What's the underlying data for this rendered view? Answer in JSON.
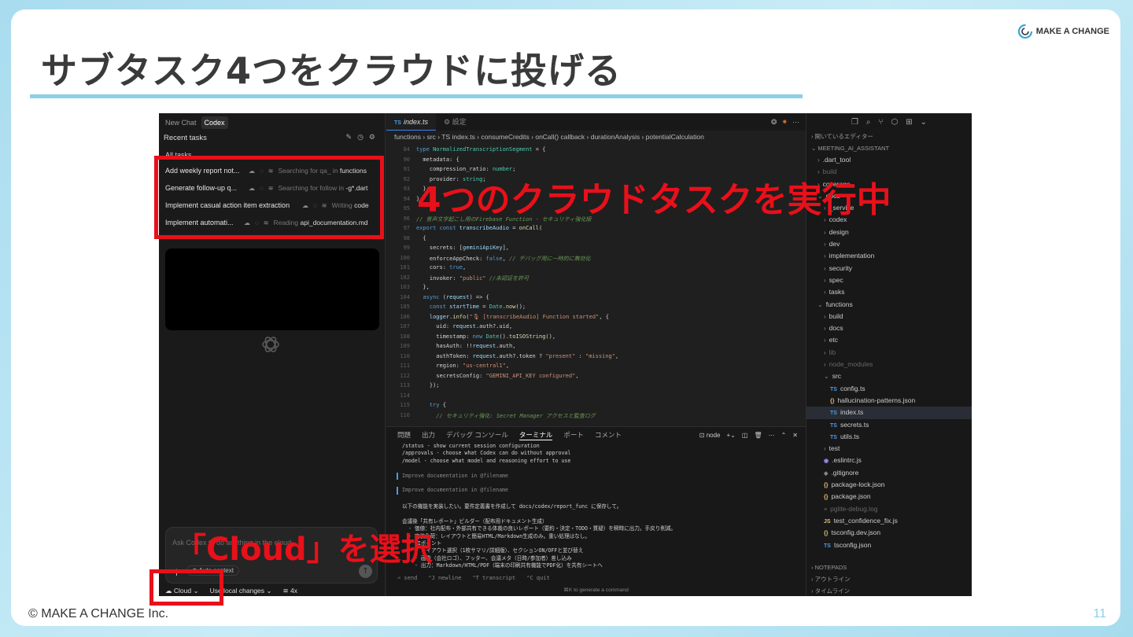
{
  "slide": {
    "title": "サブタスク4つをクラウドに投げる",
    "logo_text": "MAKE A CHANGE",
    "copyright": "© MAKE A CHANGE Inc.",
    "page_number": "11"
  },
  "annotations": {
    "tasks_label": "4つのクラウドタスクを実行中",
    "cloud_label": "「Cloud」を選択"
  },
  "codex": {
    "tabs": [
      "New Chat",
      "Codex"
    ],
    "recent_label": "Recent tasks",
    "all_tasks_label": "All tasks",
    "tasks": [
      {
        "title": "Add weekly report not...",
        "status": "Searching for qa_ in",
        "status_hl": "functions"
      },
      {
        "title": "Generate follow-up q...",
        "status": "Searching for follow in",
        "status_hl": "-g*.dart"
      },
      {
        "title": "Implement casual action item extraction",
        "status": "Writing",
        "status_hl": "code"
      },
      {
        "title": "Implement automati...",
        "status": "Reading",
        "status_hl": "api_documentation.md"
      }
    ],
    "prompt_placeholder": "Ask Codex to do anything in the cloud",
    "auto_context": "Auto context",
    "bottom": {
      "cloud": "Cloud",
      "local": "Use local changes",
      "count": "4x"
    }
  },
  "editor": {
    "tabs": [
      {
        "label": "index.ts",
        "active": true
      },
      {
        "label": "設定",
        "active": false
      }
    ],
    "breadcrumb": "functions › src › TS index.ts › consumeCredits › onCall() callback › durationAnalysis › potentialCalculation",
    "lines": [
      {
        "n": "84",
        "html": "<span class='k'>type</span> <span class='t'>NormalizedTranscriptionSegment</span> = {"
      },
      {
        "n": "90",
        "html": "  metadata: {"
      },
      {
        "n": "91",
        "html": "    compression_ratio: <span class='t'>number</span>;"
      },
      {
        "n": "92",
        "html": "    provider: <span class='t'>string</span>;"
      },
      {
        "n": "93",
        "html": "  };"
      },
      {
        "n": "94",
        "html": "};"
      },
      {
        "n": "95",
        "html": ""
      },
      {
        "n": "96",
        "html": "<span class='c'>// 音声文字起こし用のFirebase Function - セキュリティ強化版</span>"
      },
      {
        "n": "97",
        "html": "<span class='k'>export const</span> <span class='v'>transcribeAudio</span> = <span class='f'>onCall</span>("
      },
      {
        "n": "98",
        "html": "  {"
      },
      {
        "n": "99",
        "html": "    secrets: [<span class='v'>geminiApiKey</span>],"
      },
      {
        "n": "100",
        "html": "    enforceAppCheck: <span class='k'>false</span>, <span class='c'>// デバッグ用に一時的に無効化</span>"
      },
      {
        "n": "101",
        "html": "    cors: <span class='k'>true</span>,"
      },
      {
        "n": "102",
        "html": "    invoker: <span class='s'>\"public\"</span> <span class='c'>//未認証を許可</span>"
      },
      {
        "n": "103",
        "html": "  },"
      },
      {
        "n": "104",
        "html": "  <span class='k'>async</span> (<span class='v'>request</span>) => {"
      },
      {
        "n": "105",
        "html": "    <span class='k'>const</span> <span class='v'>startTime</span> = <span class='t'>Date</span>.<span class='f'>now</span>();"
      },
      {
        "n": "106",
        "html": "    <span class='v'>logger</span>.<span class='f'>info</span>(<span class='s'>\"🎙 [transcribeAudio] Function started\"</span>, {"
      },
      {
        "n": "107",
        "html": "      uid: <span class='v'>request</span>.auth?.uid,"
      },
      {
        "n": "108",
        "html": "      timestamp: <span class='k'>new</span> <span class='t'>Date</span>().<span class='f'>toISOString</span>(),"
      },
      {
        "n": "109",
        "html": "      hasAuth: !!<span class='v'>request</span>.auth,"
      },
      {
        "n": "110",
        "html": "      authToken: <span class='v'>request</span>.auth?.token ? <span class='s'>\"present\"</span> : <span class='s'>\"missing\"</span>,"
      },
      {
        "n": "111",
        "html": "      region: <span class='s'>\"us-central1\"</span>,"
      },
      {
        "n": "112",
        "html": "      secretsConfig: <span class='s'>\"GEMINI_API_KEY configured\"</span>,"
      },
      {
        "n": "113",
        "html": "    });"
      },
      {
        "n": "114",
        "html": ""
      },
      {
        "n": "115",
        "html": "    <span class='k'>try</span> {"
      },
      {
        "n": "116",
        "html": "      <span class='c'>// セキュリティ強化: Secret Manager アクセスと監査ログ</span>"
      }
    ]
  },
  "terminal": {
    "tabs": [
      "問題",
      "出力",
      "デバッグ コンソール",
      "ターミナル",
      "ポート",
      "コメント"
    ],
    "active_tab": "ターミナル",
    "shell": "node",
    "lines": [
      {
        "cls": "",
        "text": "/status - show current session configuration"
      },
      {
        "cls": "",
        "text": "/approvals - choose what Codex can do without approval"
      },
      {
        "cls": "",
        "text": "/model - choose what model and reasoning effort to use"
      },
      {
        "cls": "",
        "text": ""
      },
      {
        "cls": "bar",
        "text": "Improve documentation in @filename"
      },
      {
        "cls": "",
        "text": ""
      },
      {
        "cls": "bar",
        "text": "Improve documentation in @filename"
      },
      {
        "cls": "",
        "text": ""
      },
      {
        "cls": "",
        "text": "以下の機能を実装したい。要件定義書を作成して docs/codex/report_func に保存して。"
      },
      {
        "cls": "",
        "text": ""
      },
      {
        "cls": "",
        "text": "会議後「共有レポート」ビルダー（配布用ドキュメント生成）"
      },
      {
        "cls": "",
        "text": "  - 価値：社内配布・外部共有できる体裁の良いレポート（要約・決定・TODO・質疑）を瞬時に出力。手戻り削減。"
      },
      {
        "cls": "",
        "text": "  - 実装負荷：レイアウトと簡易HTML/Markdown生成のみ。重い処理はなし。"
      },
      {
        "cls": "",
        "text": "  - UIポイント"
      },
      {
        "cls": "",
        "text": "    - レイアウト選択（1枚サマリ/詳細版）、セクションON/OFFと並び替え"
      },
      {
        "cls": "",
        "text": "    - 画像（会社ロゴ）、フッター、会議メタ（日時/参加者）差し込み"
      },
      {
        "cls": "",
        "text": "    - 出力：Markdown/HTML/PDF（端末の印刷共有機能でPDF化）を共有シートへ"
      }
    ],
    "footer": [
      "⏎ send",
      "⌃J newline",
      "⌃T transcript",
      "⌃C quit"
    ],
    "hint": "⌘K to generate a command"
  },
  "explorer": {
    "open_editors": "開いているエディター",
    "project": "MEETING_AI_ASSISTANT",
    "items": [
      {
        "label": ".dart_tool",
        "kind": "folder",
        "indent": 1,
        "dim": false
      },
      {
        "label": "build",
        "kind": "folder",
        "indent": 1,
        "dim": true
      },
      {
        "label": "coverage",
        "kind": "folder",
        "indent": 1,
        "dim": false
      },
      {
        "label": "docs",
        "kind": "folder-open",
        "indent": 1,
        "dim": false
      },
      {
        "label": "_service",
        "kind": "folder",
        "indent": 2,
        "dim": false
      },
      {
        "label": "codex",
        "kind": "folder",
        "indent": 2,
        "dim": false
      },
      {
        "label": "design",
        "kind": "folder",
        "indent": 2,
        "dim": false
      },
      {
        "label": "dev",
        "kind": "folder",
        "indent": 2,
        "dim": false
      },
      {
        "label": "implementation",
        "kind": "folder",
        "indent": 2,
        "dim": false
      },
      {
        "label": "security",
        "kind": "folder",
        "indent": 2,
        "dim": false
      },
      {
        "label": "spec",
        "kind": "folder",
        "indent": 2,
        "dim": false
      },
      {
        "label": "tasks",
        "kind": "folder",
        "indent": 2,
        "dim": false
      },
      {
        "label": "functions",
        "kind": "folder-open",
        "indent": 1,
        "dim": false
      },
      {
        "label": "build",
        "kind": "folder",
        "indent": 2,
        "dim": false
      },
      {
        "label": "docs",
        "kind": "folder",
        "indent": 2,
        "dim": false
      },
      {
        "label": "etc",
        "kind": "folder",
        "indent": 2,
        "dim": false
      },
      {
        "label": "lib",
        "kind": "folder",
        "indent": 2,
        "dim": true
      },
      {
        "label": "node_modules",
        "kind": "folder",
        "indent": 2,
        "dim": true
      },
      {
        "label": "src",
        "kind": "folder-open",
        "indent": 2,
        "dim": false
      },
      {
        "label": "config.ts",
        "kind": "ts",
        "indent": 3,
        "dim": false
      },
      {
        "label": "hallucination-patterns.json",
        "kind": "json",
        "indent": 3,
        "dim": false
      },
      {
        "label": "index.ts",
        "kind": "ts",
        "indent": 3,
        "dim": false,
        "selected": true
      },
      {
        "label": "secrets.ts",
        "kind": "ts",
        "indent": 3,
        "dim": false
      },
      {
        "label": "utils.ts",
        "kind": "ts",
        "indent": 3,
        "dim": false
      },
      {
        "label": "test",
        "kind": "folder",
        "indent": 2,
        "dim": false
      },
      {
        "label": ".eslintrc.js",
        "kind": "eslint",
        "indent": 2,
        "dim": false
      },
      {
        "label": ".gitignore",
        "kind": "git",
        "indent": 2,
        "dim": false
      },
      {
        "label": "package-lock.json",
        "kind": "json",
        "indent": 2,
        "dim": false
      },
      {
        "label": "package.json",
        "kind": "json",
        "indent": 2,
        "dim": false
      },
      {
        "label": "pglite-debug.log",
        "kind": "log",
        "indent": 2,
        "dim": true
      },
      {
        "label": "test_confidence_fix.js",
        "kind": "js",
        "indent": 2,
        "dim": false
      },
      {
        "label": "tsconfig.dev.json",
        "kind": "json",
        "indent": 2,
        "dim": false
      },
      {
        "label": "tsconfig.json",
        "kind": "tsconfig",
        "indent": 2,
        "dim": false
      }
    ],
    "bottom_sections": [
      "NOTEPADS",
      "アウトライン",
      "タイムライン"
    ]
  },
  "colors": {
    "annotation_red": "#e8101a",
    "accent_blue": "#8dcfe8"
  }
}
